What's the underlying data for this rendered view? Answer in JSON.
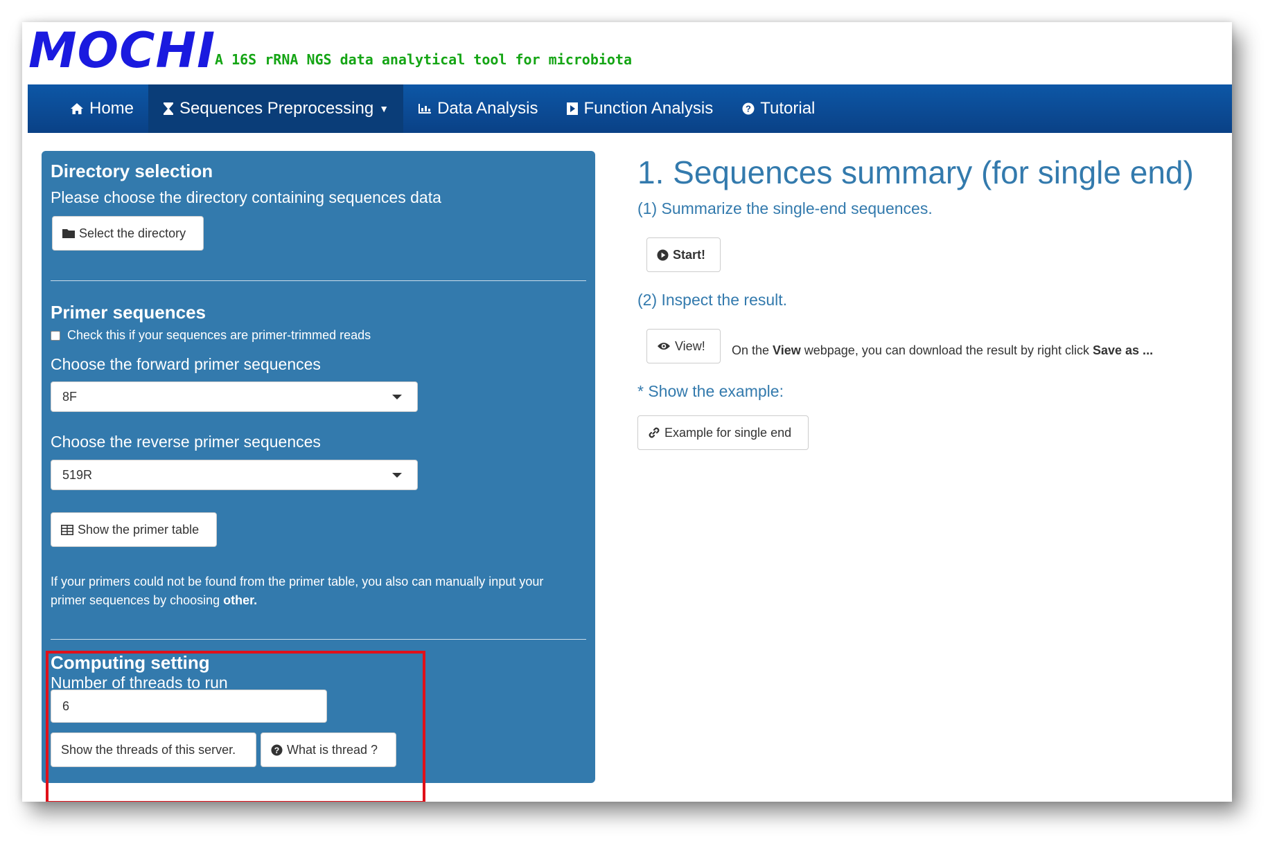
{
  "header": {
    "logo": "MOCHI",
    "tagline": "A 16S rRNA NGS data analytical tool for microbiota"
  },
  "nav": {
    "items": [
      {
        "label": "Home",
        "icon": "home-icon"
      },
      {
        "label": "Sequences Preprocessing",
        "icon": "hourglass-icon",
        "active": true,
        "dropdown": true
      },
      {
        "label": "Data Analysis",
        "icon": "bar-chart-icon"
      },
      {
        "label": "Function Analysis",
        "icon": "play-icon"
      },
      {
        "label": "Tutorial",
        "icon": "question-circle-icon"
      }
    ]
  },
  "sidebar": {
    "directory": {
      "title": "Directory selection",
      "text": "Please choose the directory containing sequences data",
      "button": "Select the directory"
    },
    "primer": {
      "title": "Primer sequences",
      "checkbox_label": "Check this if your sequences are primer-trimmed reads",
      "checkbox_checked": false,
      "forward_label": "Choose the forward primer sequences",
      "forward_value": "8F",
      "reverse_label": "Choose the reverse primer sequences",
      "reverse_value": "519R",
      "table_button": "Show the primer table",
      "note_text": "If your primers could not be found from the primer table, you also can manually input your primer sequences by choosing ",
      "note_bold": "other."
    },
    "computing": {
      "title": "Computing setting",
      "threads_label": "Number of threads to run",
      "threads_value": "6",
      "show_threads_button": "Show the threads of this server.",
      "what_thread_button": "What is thread ?"
    }
  },
  "main": {
    "title": "1. Sequences summary (for single end)",
    "step1": "(1) Summarize the single-end sequences.",
    "start_button": "Start!",
    "step2": "(2) Inspect the result.",
    "view_button": "View!",
    "hint_prefix": "On the ",
    "hint_bold1": "View",
    "hint_middle": " webpage, you can download the result by right click ",
    "hint_bold2": "Save as ...",
    "example_label": "* Show the example:",
    "example_button": "Example for single end"
  },
  "colors": {
    "navbar": "#0a4a94",
    "sidebar": "#337aad",
    "accent_text": "#337aad",
    "logo": "#1a1adf",
    "tagline": "#15a515",
    "highlight": "#e0101a"
  }
}
